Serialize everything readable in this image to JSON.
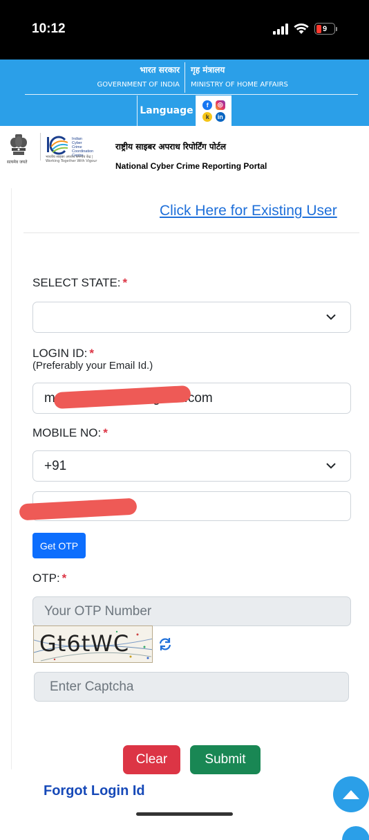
{
  "status_bar": {
    "time": "10:12",
    "battery": "9"
  },
  "gov_banner": {
    "left_hindi": "भारत सरकार",
    "left_english": "GOVERNMENT OF INDIA",
    "right_hindi": "गृह मंत्रालय",
    "right_english": "MINISTRY OF HOME AFFAIRS",
    "language_label": "Language"
  },
  "portal": {
    "emblem_caption": "सत्यमेव जयते",
    "i4c_name_lines": [
      "Indian",
      "Cyber",
      "Crime",
      "Coordination",
      "Centre"
    ],
    "i4c_tagline": "भारतीय साइबर अपराध समन्वय केंद्र | Working Together With Vigour",
    "title_hindi": "राष्ट्रीय साइबर अपराध रिपोर्टिंग पोर्टल",
    "title_english": "National Cyber Crime Reporting Portal"
  },
  "form": {
    "existing_user_link": "Click Here for Existing User",
    "state_label": "SELECT STATE:",
    "required_mark": "*",
    "state_value": "",
    "login_label": "LOGIN ID:",
    "login_hint": "(Preferably your Email Id.)",
    "login_value_start": "mehtar",
    "login_value_end": "gmail.com",
    "mobile_label": "MOBILE NO:",
    "country_code": "+91",
    "mobile_value": "",
    "get_otp_label": "Get OTP",
    "otp_label": "OTP:",
    "otp_placeholder": "Your OTP Number",
    "captcha_text": "Gt6tWC",
    "captcha_placeholder": "Enter Captcha",
    "clear_label": "Clear",
    "submit_label": "Submit",
    "forgot_link": "Forgot Login Id"
  },
  "colors": {
    "banner": "#2b9fe8",
    "link": "#1e6fd9",
    "primary": "#0d6efd",
    "danger": "#dc3545",
    "success": "#198754",
    "redaction": "#ee5a56"
  }
}
